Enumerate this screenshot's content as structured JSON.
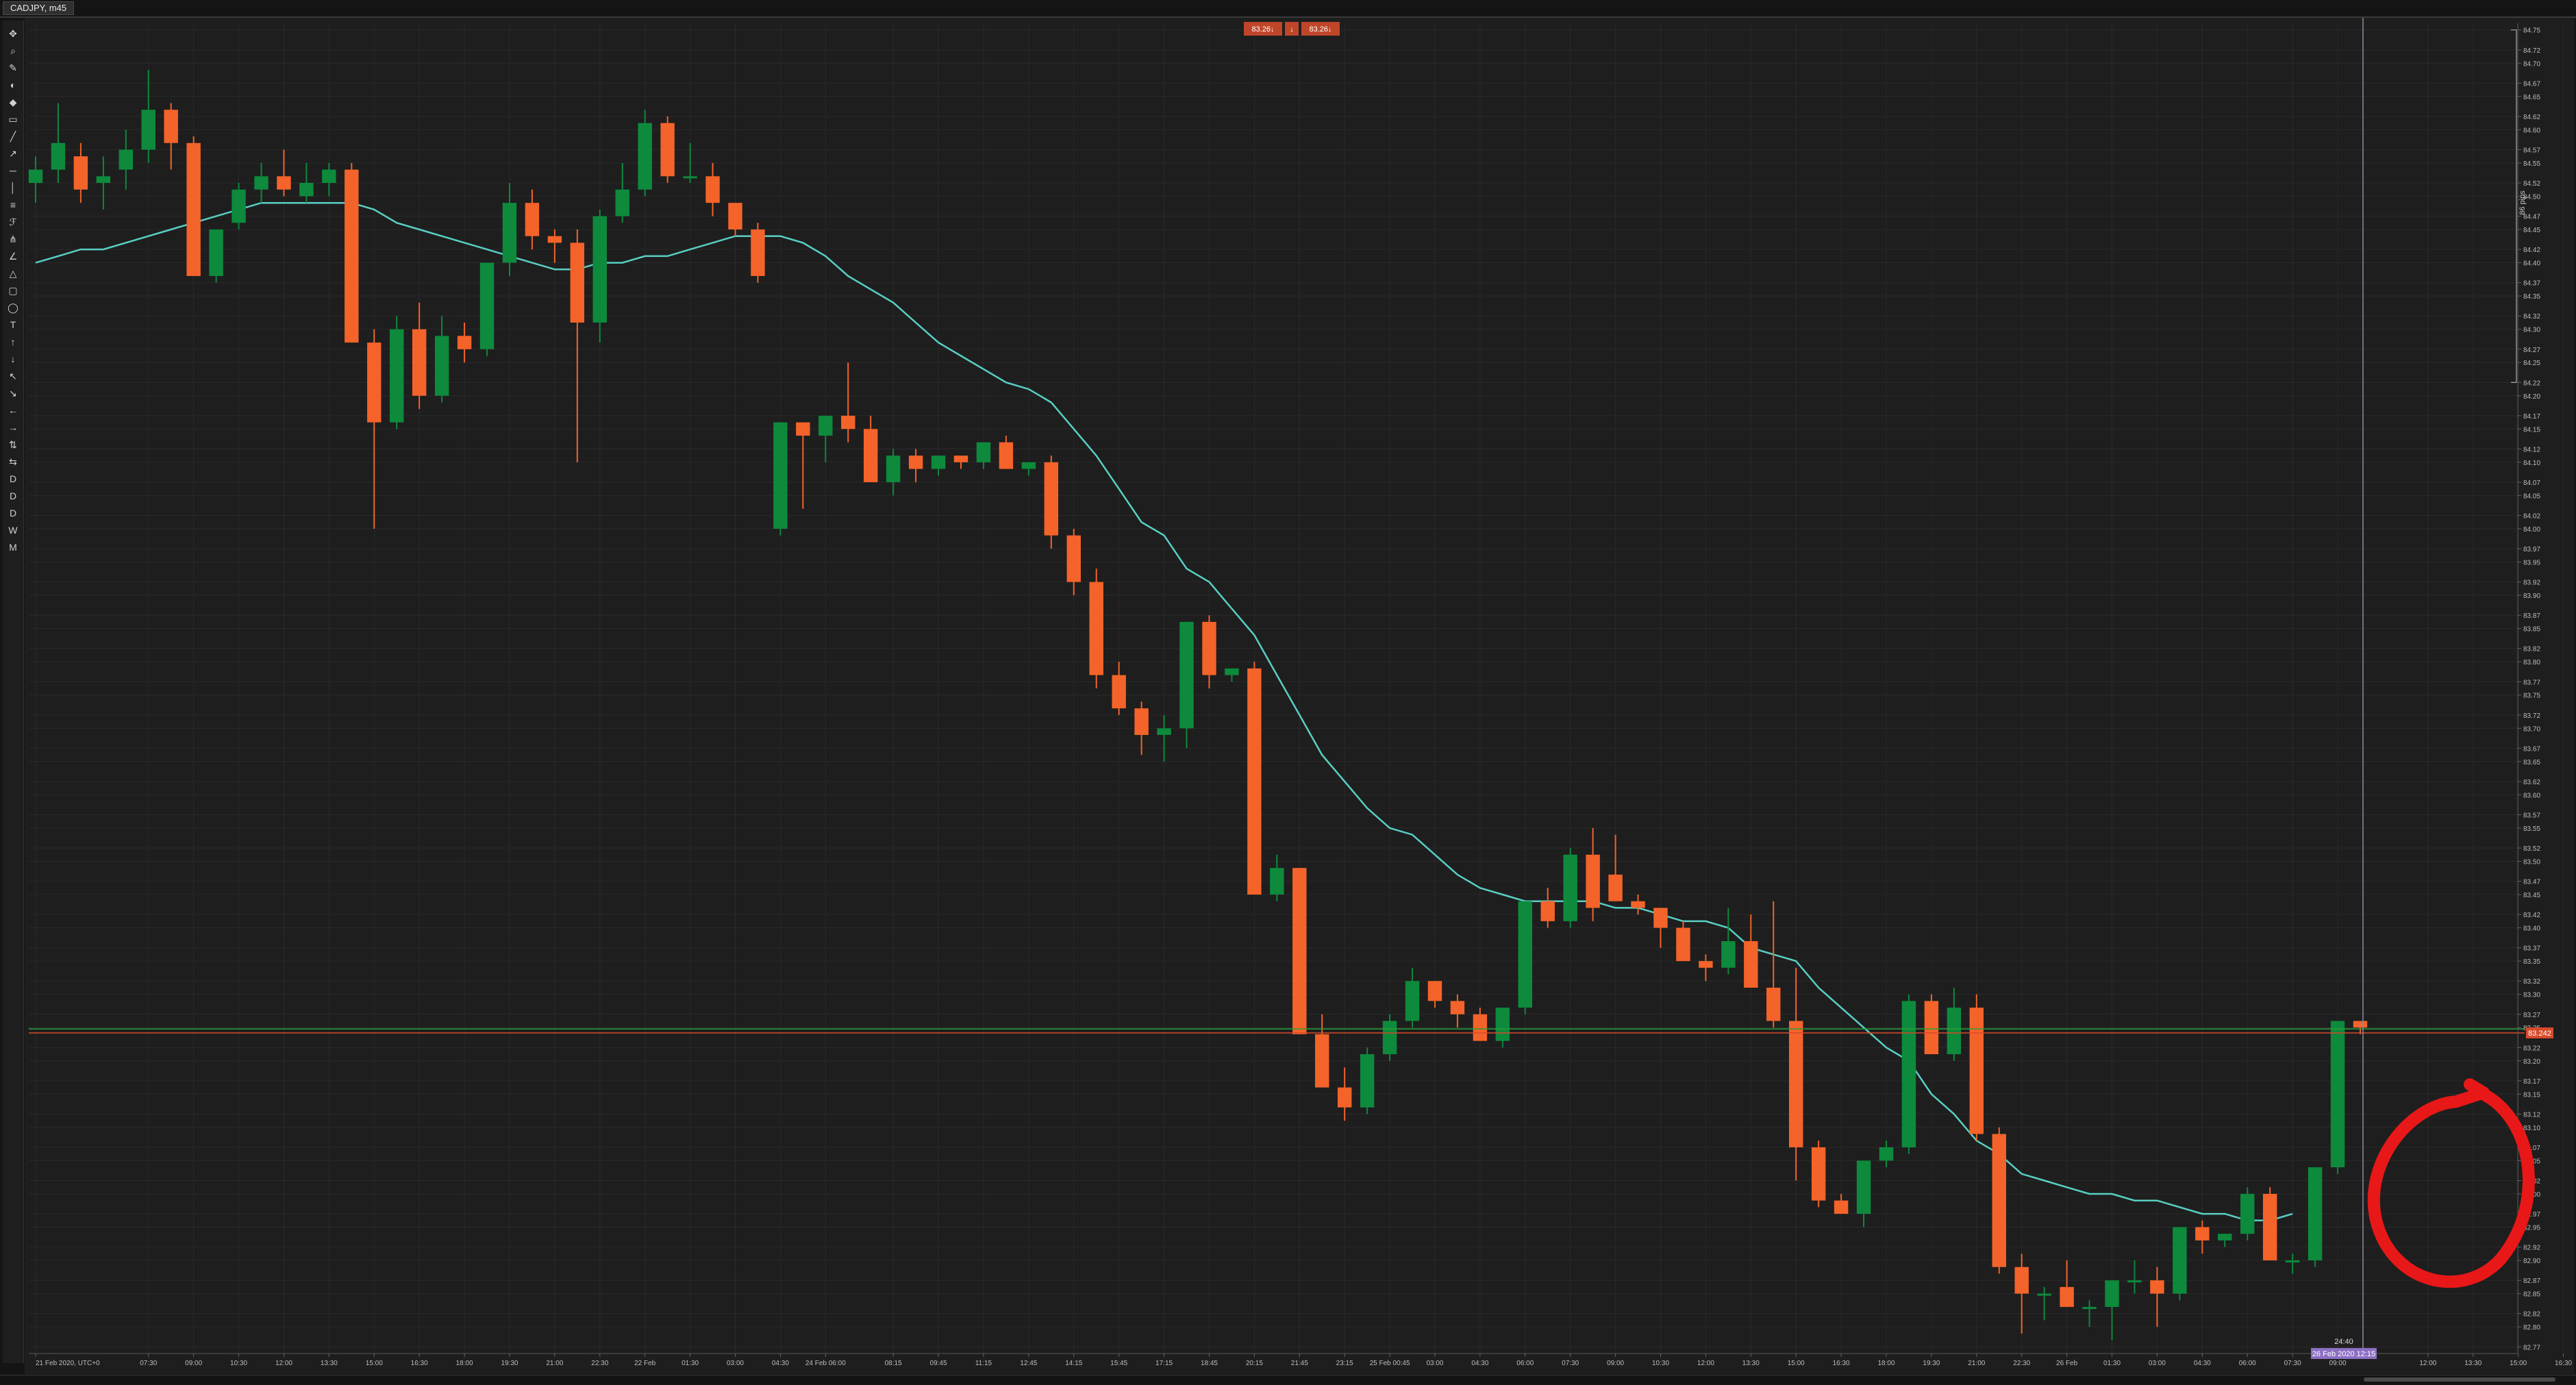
{
  "window": {
    "title": "CADJPY, m45"
  },
  "top_labels": {
    "bid": "83.26↓",
    "mid": "↓",
    "ask": "83.26↓"
  },
  "toolbar_icons": [
    "crosshair-icon",
    "magnifier-icon",
    "pencil-icon",
    "drop-icon",
    "palette-icon",
    "ruler-icon",
    "line-icon",
    "ray-icon",
    "hline-icon",
    "vline-icon",
    "channel-icon",
    "fib-icon",
    "pitchfork-icon",
    "gann-icon",
    "triangle-icon",
    "rectangle-icon",
    "ellipse-icon",
    "text-icon",
    "arrow-icon",
    "arrow-icon",
    "arrow-icon",
    "arrow-icon",
    "arrow-icon",
    "arrow-icon",
    "arrow-icon",
    "arrow-icon",
    "period-D-icon",
    "period-D-icon",
    "period-D-icon",
    "period-W-icon",
    "period-M-icon"
  ],
  "toolbar_glyphs": [
    "✥",
    "⌕",
    "✎",
    "◐",
    "◆",
    "▭",
    "╱",
    "↗",
    "─",
    "│",
    "≡",
    "ℱ",
    "⋔",
    "∠",
    "△",
    "▢",
    "◯",
    "T",
    "↑",
    "↓",
    "↖",
    "↘",
    "←",
    "→",
    "⇅",
    "⇆",
    "D",
    "D",
    "D",
    "W",
    "M"
  ],
  "pips_label": "86 pips",
  "cursor_time_label": "26 Feb 2020 12:15",
  "cursor_countdown": "24:40",
  "current_price_label": "83.242",
  "colors": {
    "background": "#1e1e1e",
    "grid": "#2a2a2a",
    "bull": "#0d8a3c",
    "bear": "#f4632a",
    "ma": "#58d0c4",
    "price_line": "#d84a2a",
    "ask_line": "#27a13a",
    "annotation": "#e81818",
    "cursor_line": "#8a8aa8"
  },
  "chart_data": {
    "type": "candlestick",
    "symbol": "CADJPY",
    "timeframe": "m45",
    "ylim": [
      82.76,
      84.76
    ],
    "y_ticks": [
      "84.75",
      "84.72",
      "84.70",
      "84.67",
      "84.65",
      "84.62",
      "84.60",
      "84.57",
      "84.55",
      "84.52",
      "84.50",
      "84.47",
      "84.45",
      "84.42",
      "84.40",
      "84.37",
      "84.35",
      "84.32",
      "84.30",
      "84.27",
      "84.25",
      "84.22",
      "84.20",
      "84.17",
      "84.15",
      "84.12",
      "84.10",
      "84.07",
      "84.05",
      "84.02",
      "84.00",
      "83.97",
      "83.95",
      "83.92",
      "83.90",
      "83.87",
      "83.85",
      "83.82",
      "83.80",
      "83.77",
      "83.75",
      "83.72",
      "83.70",
      "83.67",
      "83.65",
      "83.62",
      "83.60",
      "83.57",
      "83.55",
      "83.52",
      "83.50",
      "83.47",
      "83.45",
      "83.42",
      "83.40",
      "83.37",
      "83.35",
      "83.32",
      "83.30",
      "83.27",
      "83.25",
      "83.22",
      "83.20",
      "83.17",
      "83.15",
      "83.12",
      "83.10",
      "83.07",
      "83.05",
      "83.02",
      "83.00",
      "82.97",
      "82.95",
      "82.92",
      "82.90",
      "82.87",
      "82.85",
      "82.82",
      "82.80",
      "82.77"
    ],
    "x_ticks": [
      {
        "bar": 0,
        "label": "21 Feb 2020, UTC+0"
      },
      {
        "bar": 5,
        "label": "07:30"
      },
      {
        "bar": 7,
        "label": "09:00"
      },
      {
        "bar": 9,
        "label": "10:30"
      },
      {
        "bar": 11,
        "label": "12:00"
      },
      {
        "bar": 13,
        "label": "13:30"
      },
      {
        "bar": 15,
        "label": "15:00"
      },
      {
        "bar": 17,
        "label": "16:30"
      },
      {
        "bar": 19,
        "label": "18:00"
      },
      {
        "bar": 21,
        "label": "19:30"
      },
      {
        "bar": 23,
        "label": "21:00"
      },
      {
        "bar": 25,
        "label": "22:30"
      },
      {
        "bar": 27,
        "label": "22 Feb"
      },
      {
        "bar": 29,
        "label": "01:30"
      },
      {
        "bar": 31,
        "label": "03:00"
      },
      {
        "bar": 33,
        "label": "04:30"
      },
      {
        "bar": 35,
        "label": "24 Feb 06:00"
      },
      {
        "bar": 38,
        "label": "08:15"
      },
      {
        "bar": 40,
        "label": "09:45"
      },
      {
        "bar": 42,
        "label": "11:15"
      },
      {
        "bar": 44,
        "label": "12:45"
      },
      {
        "bar": 46,
        "label": "14:15"
      },
      {
        "bar": 48,
        "label": "15:45"
      },
      {
        "bar": 50,
        "label": "17:15"
      },
      {
        "bar": 52,
        "label": "18:45"
      },
      {
        "bar": 54,
        "label": "20:15"
      },
      {
        "bar": 56,
        "label": "21:45"
      },
      {
        "bar": 58,
        "label": "23:15"
      },
      {
        "bar": 60,
        "label": "25 Feb 00:45"
      },
      {
        "bar": 62,
        "label": "03:00"
      },
      {
        "bar": 64,
        "label": "04:30"
      },
      {
        "bar": 66,
        "label": "06:00"
      },
      {
        "bar": 68,
        "label": "07:30"
      },
      {
        "bar": 70,
        "label": "09:00"
      },
      {
        "bar": 72,
        "label": "10:30"
      },
      {
        "bar": 74,
        "label": "12:00"
      },
      {
        "bar": 76,
        "label": "13:30"
      },
      {
        "bar": 78,
        "label": "15:00"
      },
      {
        "bar": 80,
        "label": "16:30"
      },
      {
        "bar": 82,
        "label": "18:00"
      },
      {
        "bar": 84,
        "label": "19:30"
      },
      {
        "bar": 86,
        "label": "21:00"
      },
      {
        "bar": 88,
        "label": "22:30"
      },
      {
        "bar": 90,
        "label": "26 Feb"
      },
      {
        "bar": 92,
        "label": "01:30"
      },
      {
        "bar": 94,
        "label": "03:00"
      },
      {
        "bar": 96,
        "label": "04:30"
      },
      {
        "bar": 98,
        "label": "06:00"
      },
      {
        "bar": 100,
        "label": "07:30"
      },
      {
        "bar": 102,
        "label": "09:00"
      },
      {
        "bar": 106,
        "label": "12:00"
      },
      {
        "bar": 108,
        "label": "13:30"
      },
      {
        "bar": 110,
        "label": "15:00"
      },
      {
        "bar": 112,
        "label": "16:30"
      }
    ],
    "candles": [
      {
        "o": 84.52,
        "h": 84.56,
        "l": 84.49,
        "c": 84.54
      },
      {
        "o": 84.54,
        "h": 84.64,
        "l": 84.52,
        "c": 84.58
      },
      {
        "o": 84.56,
        "h": 84.58,
        "l": 84.49,
        "c": 84.51
      },
      {
        "o": 84.52,
        "h": 84.56,
        "l": 84.48,
        "c": 84.53
      },
      {
        "o": 84.54,
        "h": 84.6,
        "l": 84.51,
        "c": 84.57
      },
      {
        "o": 84.57,
        "h": 84.69,
        "l": 84.55,
        "c": 84.63
      },
      {
        "o": 84.63,
        "h": 84.64,
        "l": 84.54,
        "c": 84.58
      },
      {
        "o": 84.58,
        "h": 84.59,
        "l": 84.38,
        "c": 84.38
      },
      {
        "o": 84.38,
        "h": 84.45,
        "l": 84.37,
        "c": 84.45
      },
      {
        "o": 84.46,
        "h": 84.52,
        "l": 84.45,
        "c": 84.51
      },
      {
        "o": 84.51,
        "h": 84.55,
        "l": 84.49,
        "c": 84.53
      },
      {
        "o": 84.53,
        "h": 84.57,
        "l": 84.5,
        "c": 84.51
      },
      {
        "o": 84.5,
        "h": 84.55,
        "l": 84.49,
        "c": 84.52
      },
      {
        "o": 84.52,
        "h": 84.55,
        "l": 84.5,
        "c": 84.54
      },
      {
        "o": 84.54,
        "h": 84.55,
        "l": 84.28,
        "c": 84.28
      },
      {
        "o": 84.28,
        "h": 84.3,
        "l": 84.0,
        "c": 84.16
      },
      {
        "o": 84.16,
        "h": 84.32,
        "l": 84.15,
        "c": 84.3
      },
      {
        "o": 84.3,
        "h": 84.34,
        "l": 84.18,
        "c": 84.2
      },
      {
        "o": 84.2,
        "h": 84.32,
        "l": 84.19,
        "c": 84.29
      },
      {
        "o": 84.29,
        "h": 84.31,
        "l": 84.25,
        "c": 84.27
      },
      {
        "o": 84.27,
        "h": 84.4,
        "l": 84.26,
        "c": 84.4
      },
      {
        "o": 84.4,
        "h": 84.52,
        "l": 84.38,
        "c": 84.49
      },
      {
        "o": 84.49,
        "h": 84.51,
        "l": 84.42,
        "c": 84.44
      },
      {
        "o": 84.44,
        "h": 84.45,
        "l": 84.4,
        "c": 84.43
      },
      {
        "o": 84.43,
        "h": 84.45,
        "l": 84.1,
        "c": 84.31
      },
      {
        "o": 84.31,
        "h": 84.48,
        "l": 84.28,
        "c": 84.47
      },
      {
        "o": 84.47,
        "h": 84.55,
        "l": 84.46,
        "c": 84.51
      },
      {
        "o": 84.51,
        "h": 84.63,
        "l": 84.5,
        "c": 84.61
      },
      {
        "o": 84.61,
        "h": 84.62,
        "l": 84.52,
        "c": 84.53
      },
      {
        "o": 84.53,
        "h": 84.58,
        "l": 84.52,
        "c": 84.53
      },
      {
        "o": 84.53,
        "h": 84.55,
        "l": 84.47,
        "c": 84.49
      },
      {
        "o": 84.49,
        "h": 84.49,
        "l": 84.44,
        "c": 84.45
      },
      {
        "o": 84.45,
        "h": 84.46,
        "l": 84.37,
        "c": 84.38
      },
      {
        "o": 84.0,
        "h": 84.16,
        "l": 83.99,
        "c": 84.16
      },
      {
        "o": 84.16,
        "h": 84.16,
        "l": 84.03,
        "c": 84.14
      },
      {
        "o": 84.14,
        "h": 84.17,
        "l": 84.1,
        "c": 84.17
      },
      {
        "o": 84.17,
        "h": 84.25,
        "l": 84.13,
        "c": 84.15
      },
      {
        "o": 84.15,
        "h": 84.17,
        "l": 84.07,
        "c": 84.07
      },
      {
        "o": 84.07,
        "h": 84.12,
        "l": 84.05,
        "c": 84.11
      },
      {
        "o": 84.11,
        "h": 84.12,
        "l": 84.07,
        "c": 84.09
      },
      {
        "o": 84.09,
        "h": 84.11,
        "l": 84.08,
        "c": 84.11
      },
      {
        "o": 84.11,
        "h": 84.11,
        "l": 84.09,
        "c": 84.1
      },
      {
        "o": 84.1,
        "h": 84.13,
        "l": 84.09,
        "c": 84.13
      },
      {
        "o": 84.13,
        "h": 84.14,
        "l": 84.09,
        "c": 84.09
      },
      {
        "o": 84.09,
        "h": 84.1,
        "l": 84.08,
        "c": 84.1
      },
      {
        "o": 84.1,
        "h": 84.11,
        "l": 83.97,
        "c": 83.99
      },
      {
        "o": 83.99,
        "h": 84.0,
        "l": 83.9,
        "c": 83.92
      },
      {
        "o": 83.92,
        "h": 83.94,
        "l": 83.76,
        "c": 83.78
      },
      {
        "o": 83.78,
        "h": 83.8,
        "l": 83.72,
        "c": 83.73
      },
      {
        "o": 83.73,
        "h": 83.74,
        "l": 83.66,
        "c": 83.69
      },
      {
        "o": 83.69,
        "h": 83.72,
        "l": 83.65,
        "c": 83.7
      },
      {
        "o": 83.7,
        "h": 83.86,
        "l": 83.67,
        "c": 83.86
      },
      {
        "o": 83.86,
        "h": 83.87,
        "l": 83.76,
        "c": 83.78
      },
      {
        "o": 83.78,
        "h": 83.79,
        "l": 83.77,
        "c": 83.79
      },
      {
        "o": 83.79,
        "h": 83.8,
        "l": 83.45,
        "c": 83.45
      },
      {
        "o": 83.45,
        "h": 83.51,
        "l": 83.44,
        "c": 83.49
      },
      {
        "o": 83.49,
        "h": 83.49,
        "l": 83.24,
        "c": 83.24
      },
      {
        "o": 83.24,
        "h": 83.27,
        "l": 83.16,
        "c": 83.16
      },
      {
        "o": 83.16,
        "h": 83.19,
        "l": 83.11,
        "c": 83.13
      },
      {
        "o": 83.13,
        "h": 83.22,
        "l": 83.12,
        "c": 83.21
      },
      {
        "o": 83.21,
        "h": 83.27,
        "l": 83.2,
        "c": 83.26
      },
      {
        "o": 83.26,
        "h": 83.34,
        "l": 83.25,
        "c": 83.32
      },
      {
        "o": 83.32,
        "h": 83.32,
        "l": 83.28,
        "c": 83.29
      },
      {
        "o": 83.29,
        "h": 83.3,
        "l": 83.25,
        "c": 83.27
      },
      {
        "o": 83.27,
        "h": 83.28,
        "l": 83.23,
        "c": 83.23
      },
      {
        "o": 83.23,
        "h": 83.28,
        "l": 83.22,
        "c": 83.28
      },
      {
        "o": 83.28,
        "h": 83.44,
        "l": 83.27,
        "c": 83.44
      },
      {
        "o": 83.44,
        "h": 83.46,
        "l": 83.4,
        "c": 83.41
      },
      {
        "o": 83.41,
        "h": 83.52,
        "l": 83.4,
        "c": 83.51
      },
      {
        "o": 83.51,
        "h": 83.55,
        "l": 83.41,
        "c": 83.43
      },
      {
        "o": 83.48,
        "h": 83.54,
        "l": 83.44,
        "c": 83.44
      },
      {
        "o": 83.44,
        "h": 83.45,
        "l": 83.42,
        "c": 83.43
      },
      {
        "o": 83.43,
        "h": 83.43,
        "l": 83.37,
        "c": 83.4
      },
      {
        "o": 83.4,
        "h": 83.41,
        "l": 83.35,
        "c": 83.35
      },
      {
        "o": 83.35,
        "h": 83.36,
        "l": 83.32,
        "c": 83.34
      },
      {
        "o": 83.34,
        "h": 83.43,
        "l": 83.33,
        "c": 83.38
      },
      {
        "o": 83.38,
        "h": 83.42,
        "l": 83.31,
        "c": 83.31
      },
      {
        "o": 83.31,
        "h": 83.44,
        "l": 83.25,
        "c": 83.26
      },
      {
        "o": 83.26,
        "h": 83.34,
        "l": 83.02,
        "c": 83.07
      },
      {
        "o": 83.07,
        "h": 83.08,
        "l": 82.98,
        "c": 82.99
      },
      {
        "o": 82.99,
        "h": 83.0,
        "l": 82.97,
        "c": 82.97
      },
      {
        "o": 82.97,
        "h": 83.05,
        "l": 82.95,
        "c": 83.05
      },
      {
        "o": 83.05,
        "h": 83.08,
        "l": 83.04,
        "c": 83.07
      },
      {
        "o": 83.07,
        "h": 83.3,
        "l": 83.06,
        "c": 83.29
      },
      {
        "o": 83.29,
        "h": 83.3,
        "l": 83.21,
        "c": 83.21
      },
      {
        "o": 83.21,
        "h": 83.31,
        "l": 83.2,
        "c": 83.28
      },
      {
        "o": 83.28,
        "h": 83.3,
        "l": 83.08,
        "c": 83.09
      },
      {
        "o": 83.09,
        "h": 83.1,
        "l": 82.88,
        "c": 82.89
      },
      {
        "o": 82.89,
        "h": 82.91,
        "l": 82.79,
        "c": 82.85
      },
      {
        "o": 82.85,
        "h": 82.86,
        "l": 82.81,
        "c": 82.85
      },
      {
        "o": 82.86,
        "h": 82.9,
        "l": 82.83,
        "c": 82.83
      },
      {
        "o": 82.83,
        "h": 82.84,
        "l": 82.8,
        "c": 82.83
      },
      {
        "o": 82.83,
        "h": 82.87,
        "l": 82.78,
        "c": 82.87
      },
      {
        "o": 82.87,
        "h": 82.9,
        "l": 82.85,
        "c": 82.87
      },
      {
        "o": 82.87,
        "h": 82.89,
        "l": 82.8,
        "c": 82.85
      },
      {
        "o": 82.85,
        "h": 82.95,
        "l": 82.84,
        "c": 82.95
      },
      {
        "o": 82.95,
        "h": 82.96,
        "l": 82.91,
        "c": 82.93
      },
      {
        "o": 82.93,
        "h": 82.94,
        "l": 82.92,
        "c": 82.94
      },
      {
        "o": 82.94,
        "h": 83.01,
        "l": 82.93,
        "c": 83.0
      },
      {
        "o": 83.0,
        "h": 83.01,
        "l": 82.9,
        "c": 82.9
      },
      {
        "o": 82.9,
        "h": 82.91,
        "l": 82.88,
        "c": 82.9
      },
      {
        "o": 82.9,
        "h": 83.04,
        "l": 82.89,
        "c": 83.04
      },
      {
        "o": 83.04,
        "h": 83.26,
        "l": 83.03,
        "c": 83.26
      },
      {
        "o": 83.26,
        "h": 83.26,
        "l": 83.24,
        "c": 83.25
      }
    ],
    "moving_average": [
      84.4,
      84.41,
      84.42,
      84.42,
      84.43,
      84.44,
      84.45,
      84.46,
      84.47,
      84.48,
      84.49,
      84.49,
      84.49,
      84.49,
      84.49,
      84.48,
      84.46,
      84.45,
      84.44,
      84.43,
      84.42,
      84.41,
      84.4,
      84.39,
      84.39,
      84.4,
      84.4,
      84.41,
      84.41,
      84.42,
      84.43,
      84.44,
      84.44,
      84.44,
      84.43,
      84.41,
      84.38,
      84.36,
      84.34,
      84.31,
      84.28,
      84.26,
      84.24,
      84.22,
      84.21,
      84.19,
      84.15,
      84.11,
      84.06,
      84.01,
      83.99,
      83.94,
      83.92,
      83.88,
      83.84,
      83.78,
      83.72,
      83.66,
      83.62,
      83.58,
      83.55,
      83.54,
      83.51,
      83.48,
      83.46,
      83.45,
      83.44,
      83.44,
      83.44,
      83.44,
      83.43,
      83.43,
      83.42,
      83.41,
      83.41,
      83.4,
      83.37,
      83.36,
      83.35,
      83.31,
      83.28,
      83.25,
      83.22,
      83.2,
      83.15,
      83.12,
      83.08,
      83.06,
      83.03,
      83.02,
      83.01,
      83.0,
      83.0,
      82.99,
      82.99,
      82.98,
      82.97,
      82.97,
      82.96,
      82.96,
      82.97
    ],
    "current_price": 83.242,
    "ask_price": 83.245,
    "pips_bracket": [
      84.75,
      84.22
    ]
  }
}
